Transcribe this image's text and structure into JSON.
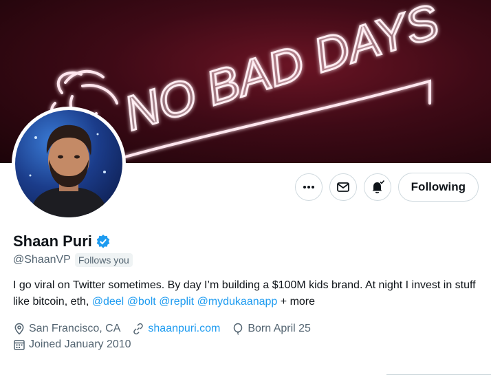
{
  "banner": {
    "sign_text": "NO BAD DAYS"
  },
  "profile": {
    "name": "Shaan Puri",
    "handle": "@ShaanVP",
    "follows_you": "Follows you",
    "bio_text": "I go viral on Twitter sometimes. By day I’m building a $100M kids brand. At night I invest in stuff like bitcoin, eth, ",
    "mentions": [
      "@deel",
      "@bolt",
      "@replit",
      "@mydukaanapp"
    ],
    "bio_more": "+ more",
    "location": "San Francisco, CA",
    "website": "shaanpuri.com",
    "birthday": "Born April 25",
    "joined": "Joined January 2010"
  },
  "actions": {
    "more_icon": "more-dots-icon",
    "message_icon": "envelope-icon",
    "notify_icon": "bell-check-icon",
    "follow_label": "Following"
  },
  "colors": {
    "link": "#1d9bf0",
    "verified": "#1d9bf0",
    "text": "#0f1419",
    "muted": "#536471"
  }
}
